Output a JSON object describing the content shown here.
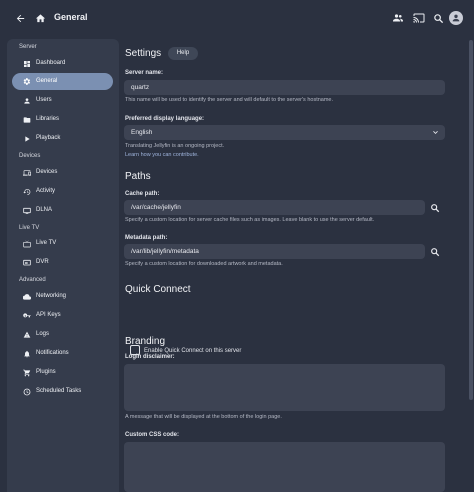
{
  "header": {
    "title": "General",
    "icons": [
      "back-arrow-icon",
      "home-icon",
      "users-icon",
      "cast-icon",
      "search-icon",
      "avatar"
    ]
  },
  "sidebar": {
    "sections": [
      {
        "header": "Server",
        "items": [
          {
            "label": "Dashboard",
            "icon": "dashboard-icon"
          },
          {
            "label": "General",
            "icon": "gear-icon",
            "active": true
          },
          {
            "label": "Users",
            "icon": "user-icon"
          },
          {
            "label": "Libraries",
            "icon": "folder-icon"
          },
          {
            "label": "Playback",
            "icon": "play-icon"
          }
        ]
      },
      {
        "header": "Devices",
        "items": [
          {
            "label": "Devices",
            "icon": "devices-icon"
          },
          {
            "label": "Activity",
            "icon": "activity-icon"
          },
          {
            "label": "DLNA",
            "icon": "dlna-icon"
          }
        ]
      },
      {
        "header": "Live TV",
        "items": [
          {
            "label": "Live TV",
            "icon": "tv-icon"
          },
          {
            "label": "DVR",
            "icon": "dvr-icon"
          }
        ]
      },
      {
        "header": "Advanced",
        "items": [
          {
            "label": "Networking",
            "icon": "cloud-icon"
          },
          {
            "label": "API Keys",
            "icon": "key-icon"
          },
          {
            "label": "Logs",
            "icon": "logs-icon"
          },
          {
            "label": "Notifications",
            "icon": "bell-icon"
          },
          {
            "label": "Plugins",
            "icon": "cart-icon"
          },
          {
            "label": "Scheduled Tasks",
            "icon": "clock-icon"
          }
        ]
      }
    ]
  },
  "settings": {
    "title": "Settings",
    "help_label": "Help",
    "server_name": {
      "label": "Server name:",
      "value": "quartz",
      "desc": "This name will be used to identify the server and will default to the server's hostname."
    },
    "language": {
      "label": "Preferred display language:",
      "value": "English",
      "desc": "Translating Jellyfin is an ongoing project.",
      "link": "Learn how you can contribute."
    }
  },
  "paths": {
    "title": "Paths",
    "cache": {
      "label": "Cache path:",
      "value": "/var/cache/jellyfin",
      "desc": "Specify a custom location for server cache files such as images. Leave blank to use the server default."
    },
    "metadata": {
      "label": "Metadata path:",
      "value": "/var/lib/jellyfin/metadata",
      "desc": "Specify a custom location for downloaded artwork and metadata."
    }
  },
  "quick_connect": {
    "title": "Quick Connect",
    "checkbox_label": "Enable Quick Connect on this server",
    "checked": false
  },
  "branding": {
    "title": "Branding",
    "disclaimer_label": "Login disclaimer:",
    "disclaimer_value": "",
    "disclaimer_desc": "A message that will be displayed at the bottom of the login page.",
    "css_label": "Custom CSS code:",
    "css_value": ""
  },
  "colors": {
    "background": "#2b3140",
    "sidebar": "#353c4c",
    "active_item": "#7b90b2",
    "field": "#3d4353",
    "link": "#9fb4dc"
  }
}
